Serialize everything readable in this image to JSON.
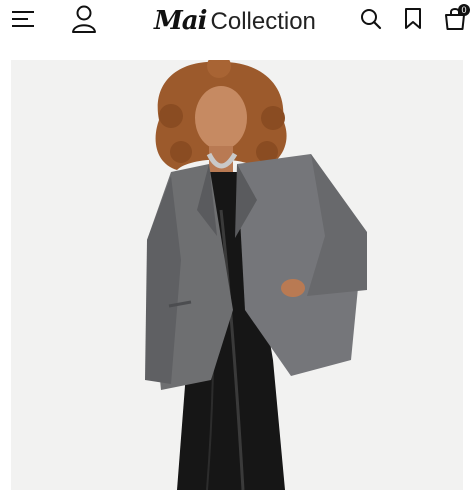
{
  "header": {
    "logo_script": "Mai",
    "logo_word": "Collection",
    "cart_count": "0"
  },
  "icons": {
    "menu": "hamburger-menu-icon",
    "account": "user-icon",
    "search": "search-icon",
    "wishlist": "bookmark-icon",
    "cart": "shopping-bag-icon"
  },
  "colors": {
    "background": "#ffffff",
    "icon": "#111111",
    "photo_background": "#f2f2f1"
  }
}
